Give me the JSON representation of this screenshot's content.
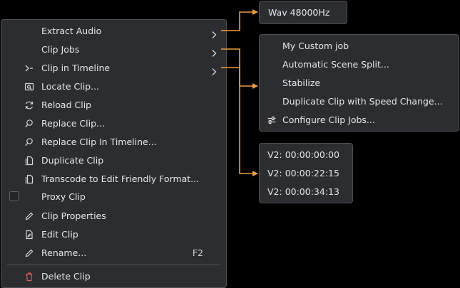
{
  "main_menu": {
    "items": [
      {
        "label": "Extract Audio"
      },
      {
        "label": "Clip Jobs"
      },
      {
        "label": "Clip in Timeline"
      },
      {
        "label": "Locate Clip..."
      },
      {
        "label": "Reload Clip"
      },
      {
        "label": "Replace Clip..."
      },
      {
        "label": "Replace Clip In Timeline..."
      },
      {
        "label": "Duplicate Clip"
      },
      {
        "label": "Transcode to Edit Friendly Format..."
      },
      {
        "label": "Proxy Clip"
      },
      {
        "label": "Clip Properties"
      },
      {
        "label": "Edit Clip"
      },
      {
        "label": "Rename...",
        "shortcut": "F2"
      },
      {
        "label": "Delete Clip"
      }
    ]
  },
  "extract_audio_submenu": {
    "items": [
      {
        "label": "Wav 48000Hz"
      }
    ]
  },
  "clip_jobs_submenu": {
    "items": [
      {
        "label": "My Custom job"
      },
      {
        "label": "Automatic Scene Split..."
      },
      {
        "label": "Stabilize"
      },
      {
        "label": "Duplicate Clip with Speed Change..."
      },
      {
        "label": "Configure Clip Jobs..."
      }
    ]
  },
  "clip_in_timeline_submenu": {
    "items": [
      {
        "label": "V2: 00:00:00:00"
      },
      {
        "label": "V2: 00:00:22:15"
      },
      {
        "label": "V2: 00:00:34:13"
      }
    ]
  },
  "colors": {
    "menu_bg": "#2b2d30",
    "border": "#4d5055",
    "text": "#e6e6e6",
    "connector": "#f39c3c",
    "delete_icon": "#e05a5a"
  }
}
